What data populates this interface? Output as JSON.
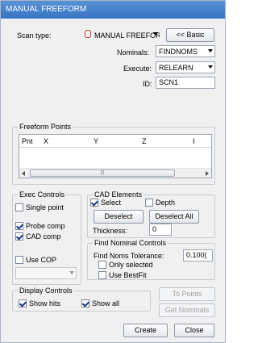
{
  "window": {
    "title": "MANUAL FREEFORM"
  },
  "scan_type": {
    "label": "Scan type:",
    "value": "MANUAL FREEFORM",
    "basic_button": "<< Basic"
  },
  "nominals": {
    "label": "Nominals:",
    "value": "FINDNOMS"
  },
  "execute": {
    "label": "Execute:",
    "value": "RELEARN"
  },
  "id": {
    "label": "ID:",
    "value": "SCN1"
  },
  "freeform_points": {
    "title": "Freeform Points",
    "columns": [
      "Pnt",
      "X",
      "Y",
      "Z",
      "I"
    ],
    "scroll_thumb": "|||"
  },
  "exec_controls": {
    "title": "Exec Controls",
    "single_point": {
      "label": "Single point",
      "checked": false
    },
    "probe_comp": {
      "label": "Probe comp",
      "checked": true
    },
    "cad_comp": {
      "label": "CAD comp",
      "checked": true
    },
    "use_cop": {
      "label": "Use COP",
      "checked": false
    },
    "cop_select_value": ""
  },
  "cad_elements": {
    "title": "CAD Elements",
    "select": {
      "label": "Select",
      "checked": true
    },
    "depth": {
      "label": "Depth",
      "checked": false
    },
    "deselect_button": "Deselect",
    "deselect_all_button": "Deselect All",
    "thickness_label": "Thickness:",
    "thickness_value": "0"
  },
  "find_nominal": {
    "title": "Find Nominal Controls",
    "tolerance_label": "Find Noms Tolerance:",
    "tolerance_value": "0.100(",
    "only_selected": {
      "label": "Only selected",
      "checked": false
    },
    "use_bestfit": {
      "label": "Use BestFit",
      "checked": false
    }
  },
  "display_controls": {
    "title": "Display Controls",
    "show_hits": {
      "label": "Show hits",
      "checked": true
    },
    "show_all": {
      "label": "Show all",
      "checked": true
    }
  },
  "buttons": {
    "to_points": "To Points",
    "get_nominals": "Get Nominals",
    "create": "Create",
    "close": "Close"
  }
}
